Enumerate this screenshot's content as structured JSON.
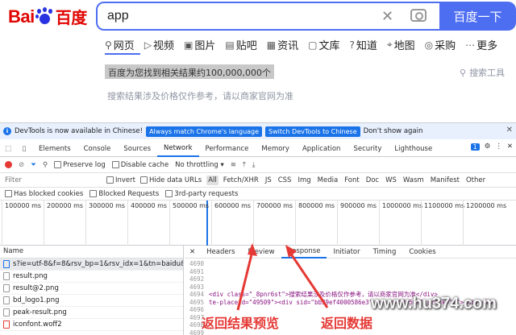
{
  "baidu": {
    "logo_en": "Bai",
    "logo_cn": "百度",
    "search_value": "app",
    "search_button": "百度一下",
    "tabs": [
      {
        "icon": "search-icon",
        "label": "网页"
      },
      {
        "icon": "video-icon",
        "label": "视频"
      },
      {
        "icon": "image-icon",
        "label": "图片"
      },
      {
        "icon": "tieba-icon",
        "label": "贴吧"
      },
      {
        "icon": "news-icon",
        "label": "资讯"
      },
      {
        "icon": "wenku-icon",
        "label": "文库"
      },
      {
        "icon": "zhidao-icon",
        "label": "知道"
      },
      {
        "icon": "map-icon",
        "label": "地图"
      },
      {
        "icon": "purchase-icon",
        "label": "采购"
      },
      {
        "icon": "more-icon",
        "label": "更多"
      }
    ],
    "result_count": "百度为您找到相关结果约100,000,000个",
    "notice": "搜索结果涉及价格仅作参考，请以商家官网为准",
    "tools": "搜索工具"
  },
  "devtools": {
    "info_text": "DevTools is now available in Chinese!",
    "info_btn1": "Always match Chrome's language",
    "info_btn2": "Switch DevTools to Chinese",
    "info_dismiss": "Don't show again",
    "panels": [
      "Elements",
      "Console",
      "Sources",
      "Network",
      "Performance",
      "Memory",
      "Application",
      "Security",
      "Lighthouse"
    ],
    "badge": "1",
    "toolbar": {
      "preserve_log": "Preserve log",
      "disable_cache": "Disable cache",
      "throttling": "No throttling"
    },
    "filter": {
      "placeholder": "Filter",
      "invert": "Invert",
      "hide_data_urls": "Hide data URLs",
      "types": [
        "All",
        "Fetch/XHR",
        "JS",
        "CSS",
        "Img",
        "Media",
        "Font",
        "Doc",
        "WS",
        "Wasm",
        "Manifest",
        "Other"
      ]
    },
    "blocked": {
      "cookies": "Has blocked cookies",
      "requests": "Blocked Requests",
      "third_party": "3rd-party requests"
    },
    "timeline_ticks": [
      "100000 ms",
      "200000 ms",
      "300000 ms",
      "400000 ms",
      "500000 ms",
      "600000 ms",
      "700000 ms",
      "800000 ms",
      "900000 ms",
      "1000000 ms",
      "1100000 ms",
      "1200000 ms"
    ],
    "requests_header": "Name",
    "requests": [
      "s?ie=utf-8&f=8&rsv_bp=1&rsv_idx=1&tn=baidu&w",
      "result.png",
      "result@2.png",
      "bd_logo1.png",
      "peak-result.png",
      "iconfont.woff2"
    ],
    "detail_tabs": [
      "Headers",
      "Preview",
      "Response",
      "Initiator",
      "Timing",
      "Cookies"
    ],
    "code_lines": [
      {
        "n": "4690",
        "t": ""
      },
      {
        "n": "4691",
        "t": ""
      },
      {
        "n": "4692",
        "t": ""
      },
      {
        "n": "4693",
        "t": ""
      },
      {
        "n": "4694",
        "t": "    <div class=\"_8pnr6st\">搜索结果涉及价格仅作参考，请以商家官网为准</div>"
      },
      {
        "n": "4695",
        "t": "te-placeid=\"49509\"><div sid=\"bb39ef4000586e3\" posid=\"49509\" prank=\"2\"><div clas"
      },
      {
        "n": "4696",
        "t": ""
      },
      {
        "n": "4697",
        "t": ""
      },
      {
        "n": "4698",
        "t": ""
      },
      {
        "n": "4699",
        "t": ""
      }
    ]
  },
  "annotations": {
    "preview": "返回结果预览",
    "data": "返回数据"
  },
  "watermark": "www.hu374.com"
}
